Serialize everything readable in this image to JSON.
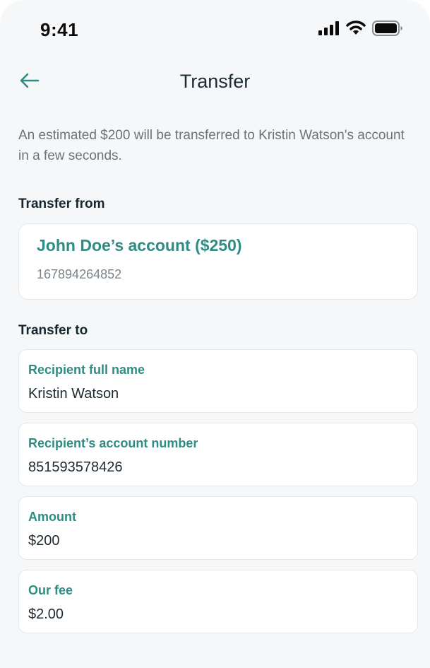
{
  "status_bar": {
    "time": "9:41",
    "icons": [
      "signal-icon",
      "wifi-icon",
      "battery-icon"
    ]
  },
  "header": {
    "back_icon": "arrow-left-icon",
    "title": "Transfer"
  },
  "description": "An estimated $200 will be transferred to Kristin Watson's account in a few seconds.",
  "transfer_from": {
    "label": "Transfer from",
    "account_name": "John Doe’s account ($250)",
    "account_number": "167894264852"
  },
  "transfer_to": {
    "label": "Transfer to",
    "fields": [
      {
        "label": "Recipient full name",
        "value": "Kristin Watson"
      },
      {
        "label": "Recipient’s account number",
        "value": "851593578426"
      },
      {
        "label": "Amount",
        "value": "$200"
      },
      {
        "label": "Our fee",
        "value": "$2.00"
      }
    ]
  },
  "colors": {
    "accent": "#2f8c84",
    "background": "#f5f7f9",
    "card": "#ffffff",
    "text_dark": "#1b2b33",
    "text_muted": "#6a7378"
  }
}
